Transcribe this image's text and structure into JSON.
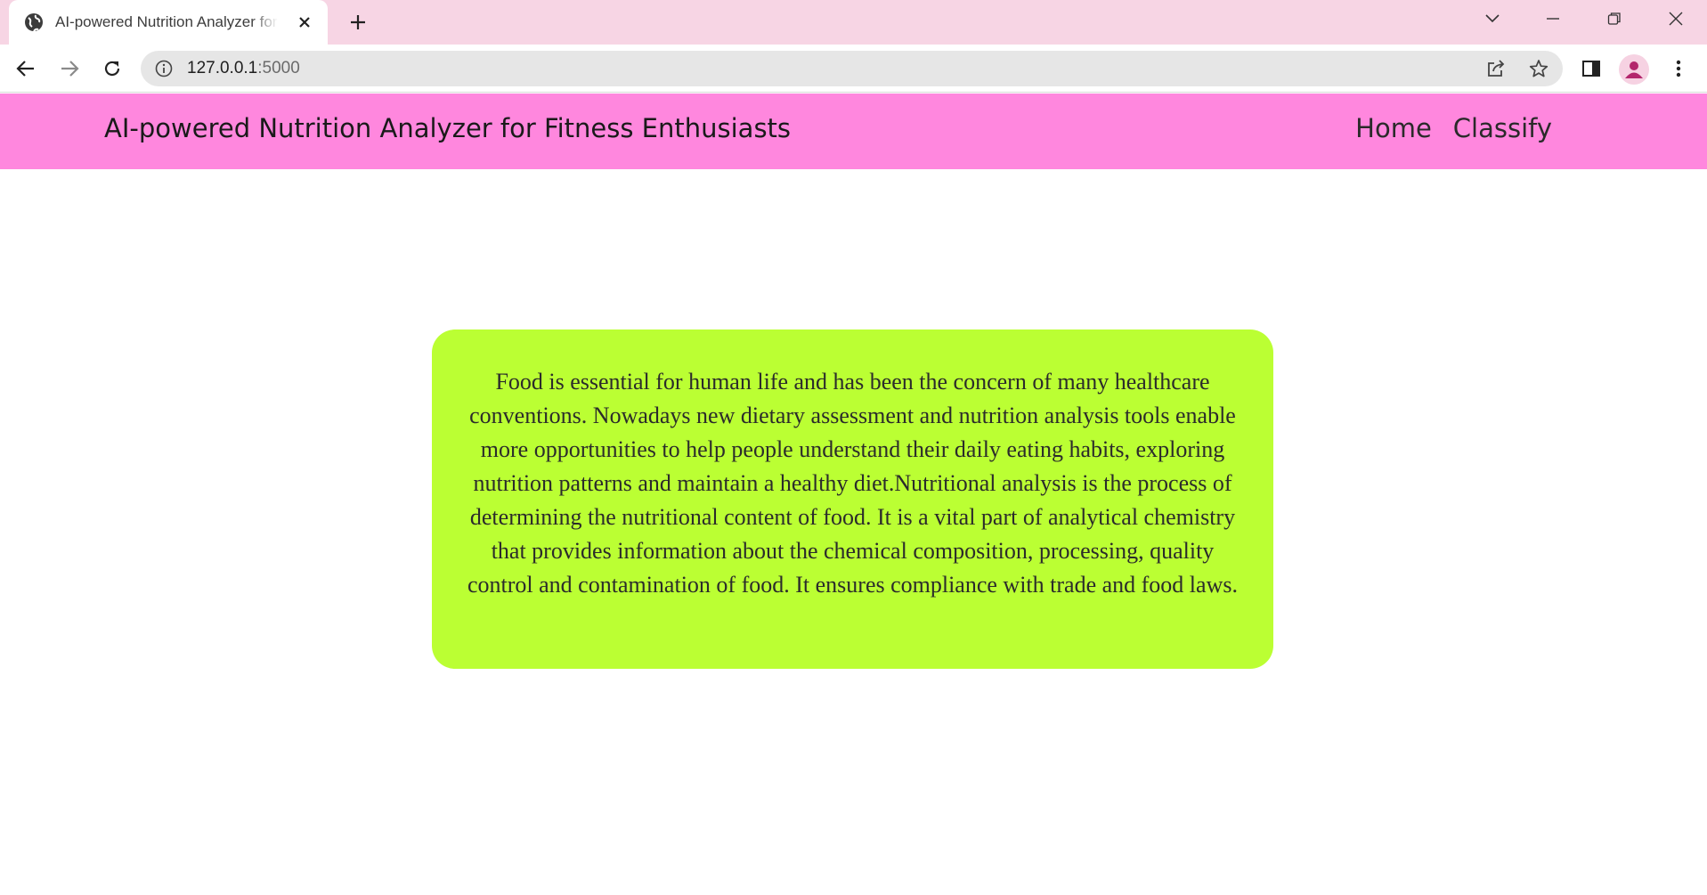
{
  "browser": {
    "tab_title": "AI-powered Nutrition Analyzer for Fitness Enthusiasts",
    "url_host": "127.0.0.1",
    "url_port": ":5000"
  },
  "navbar": {
    "brand": "AI-powered Nutrition Analyzer for Fitness Enthusiasts",
    "links": [
      {
        "label": "Home"
      },
      {
        "label": "Classify"
      }
    ]
  },
  "main": {
    "paragraph": "Food is essential for human life and has been the concern of many healthcare conventions. Nowadays new dietary assessment and nutrition analysis tools enable more opportunities to help people understand their daily eating habits, exploring nutrition patterns and maintain a healthy diet.Nutritional analysis is the process of determining the nutritional content of food. It is a vital part of analytical chemistry that provides information about the chemical composition, processing, quality control and contamination of food. It ensures compliance with trade and food laws."
  },
  "colors": {
    "tabstrip": "#f7d5e4",
    "navbar": "#ff87de",
    "card": "#bbff33"
  },
  "icons": [
    "globe-icon",
    "close-icon",
    "plus-icon",
    "chevron-down-icon",
    "minimize-icon",
    "restore-icon",
    "window-close-icon",
    "back-arrow-icon",
    "forward-arrow-icon",
    "reload-icon",
    "info-icon",
    "share-icon",
    "star-icon",
    "side-panel-icon",
    "profile-icon",
    "kebab-menu-icon"
  ]
}
